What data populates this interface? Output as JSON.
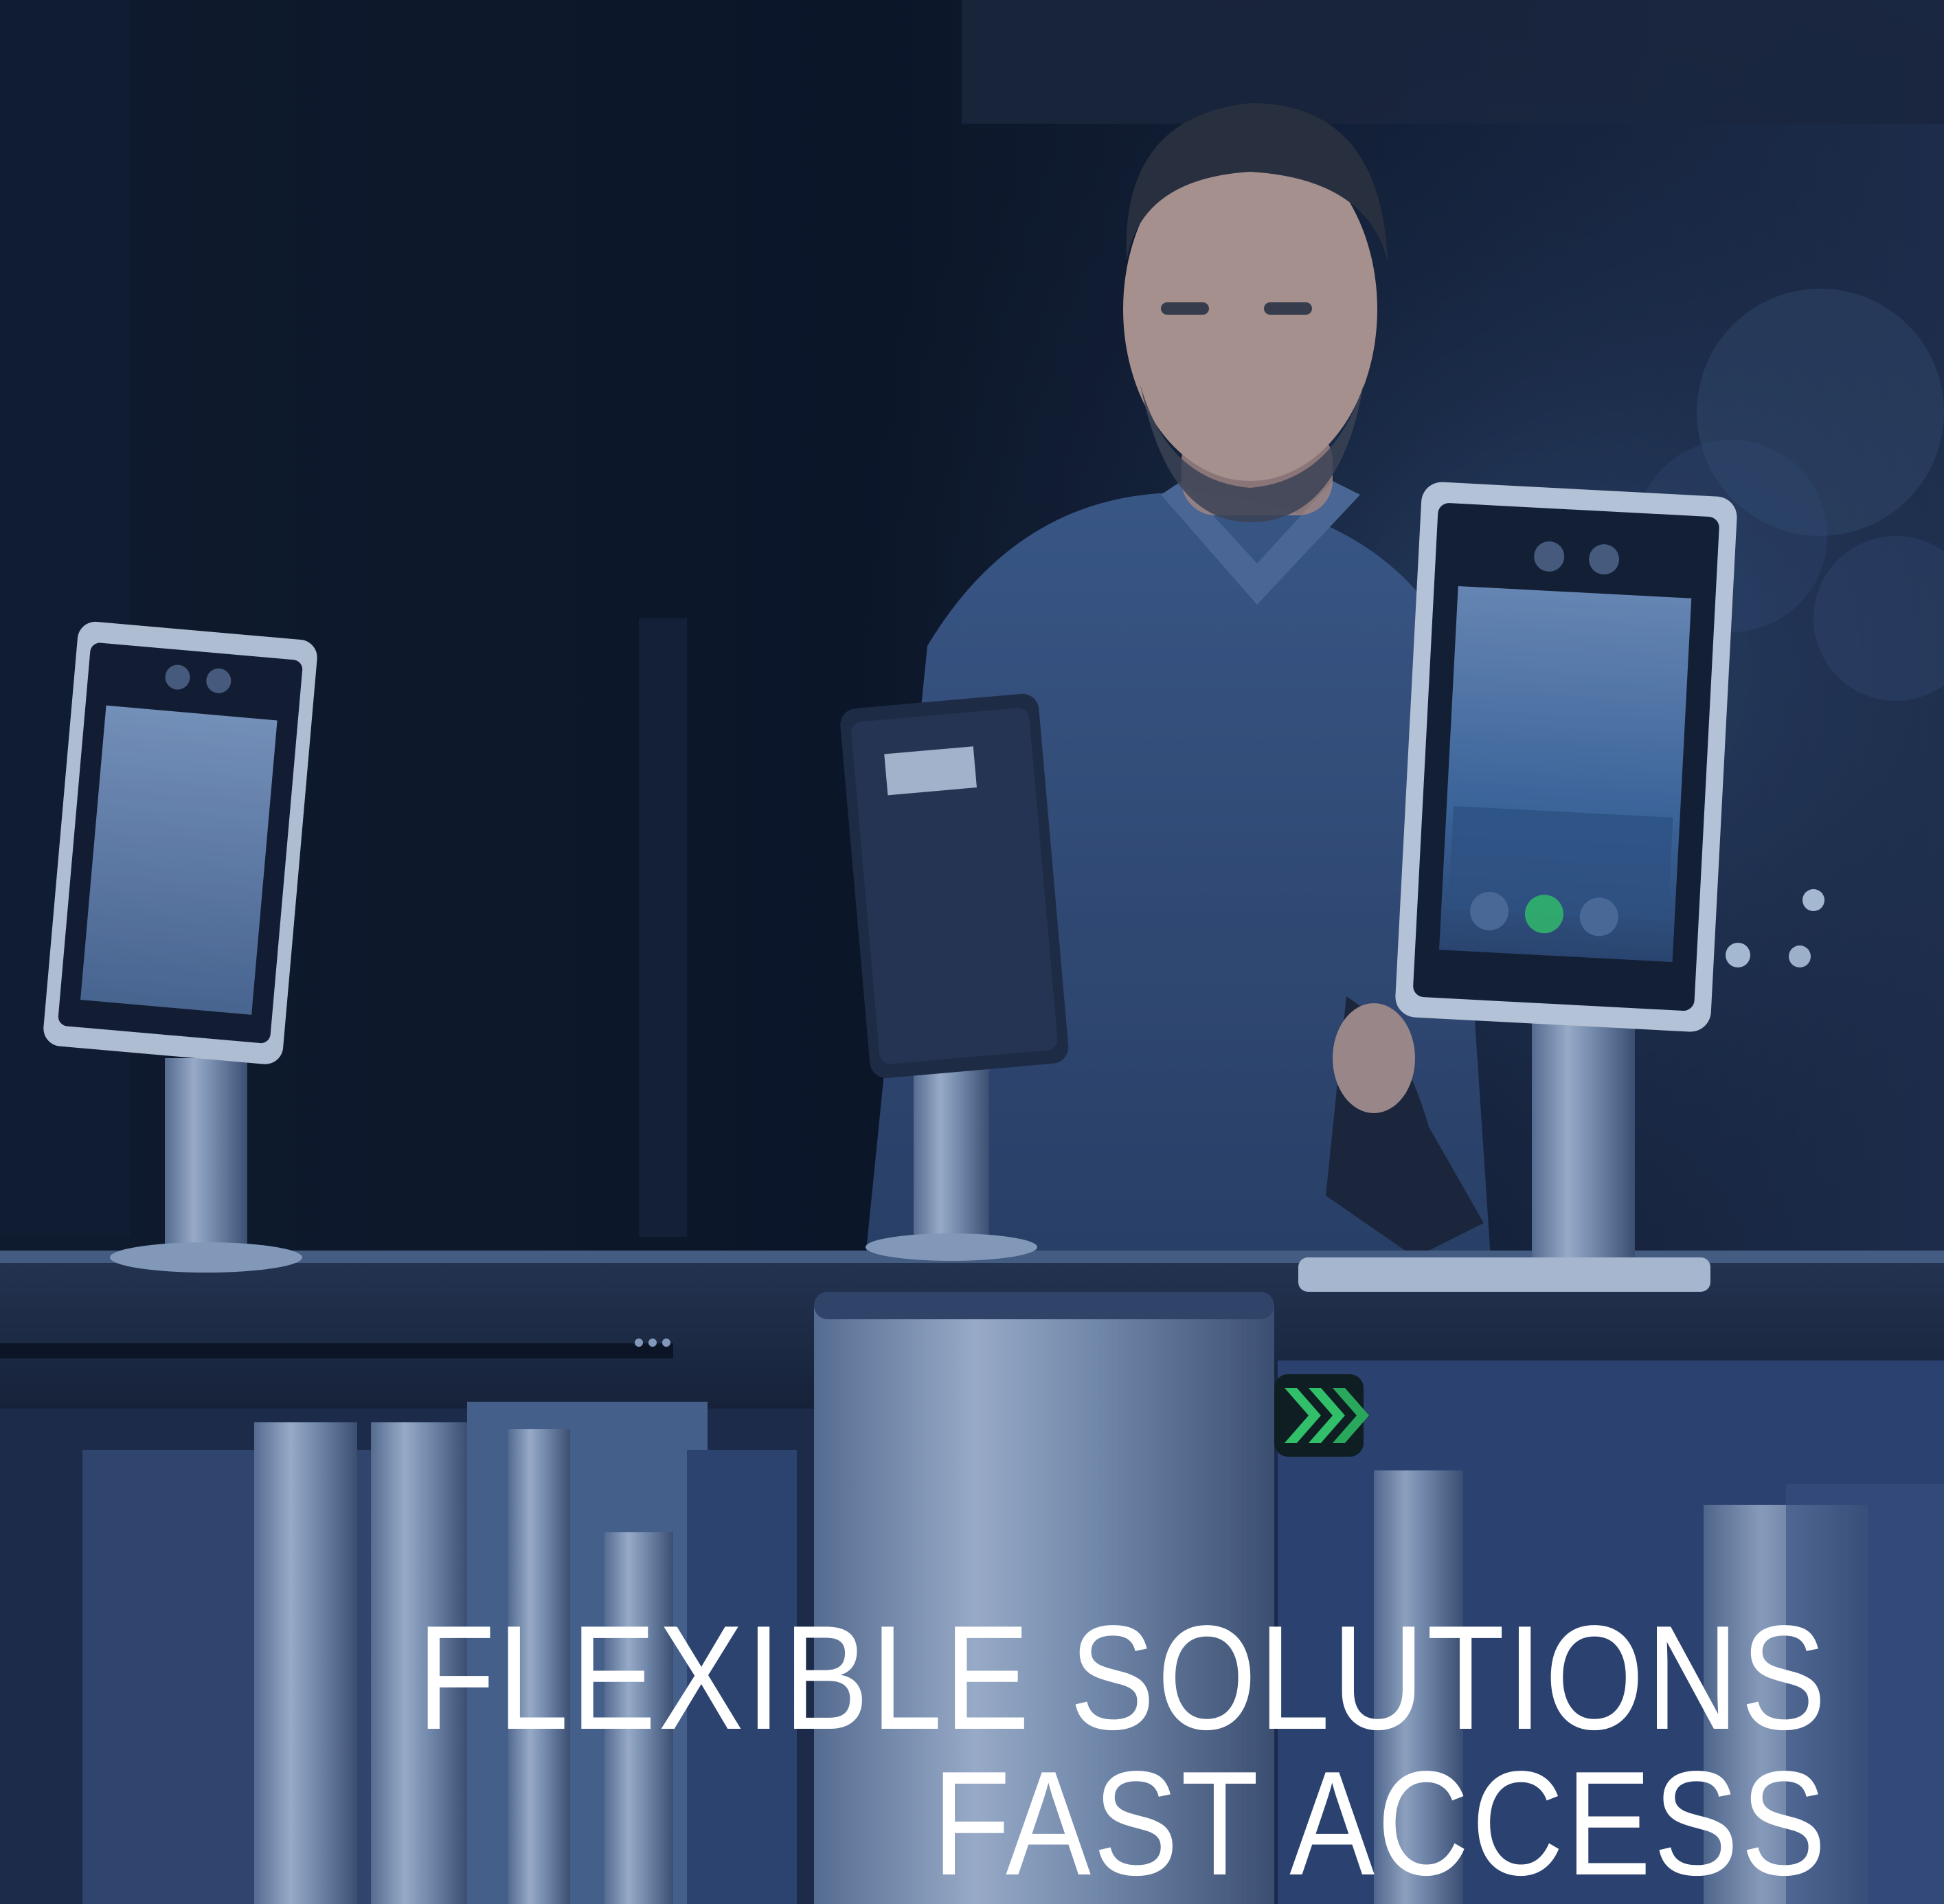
{
  "headline": {
    "line1": "FLEXIBLE SOLUTIONS",
    "line2": "FAST ACCESS"
  },
  "colors": {
    "background": "#0b1322",
    "steel": "#8fa6c4",
    "indicator": "#35d26a",
    "text": "#ffffff"
  },
  "icons": {
    "pass_indicator": "green-chevron-arrows"
  }
}
